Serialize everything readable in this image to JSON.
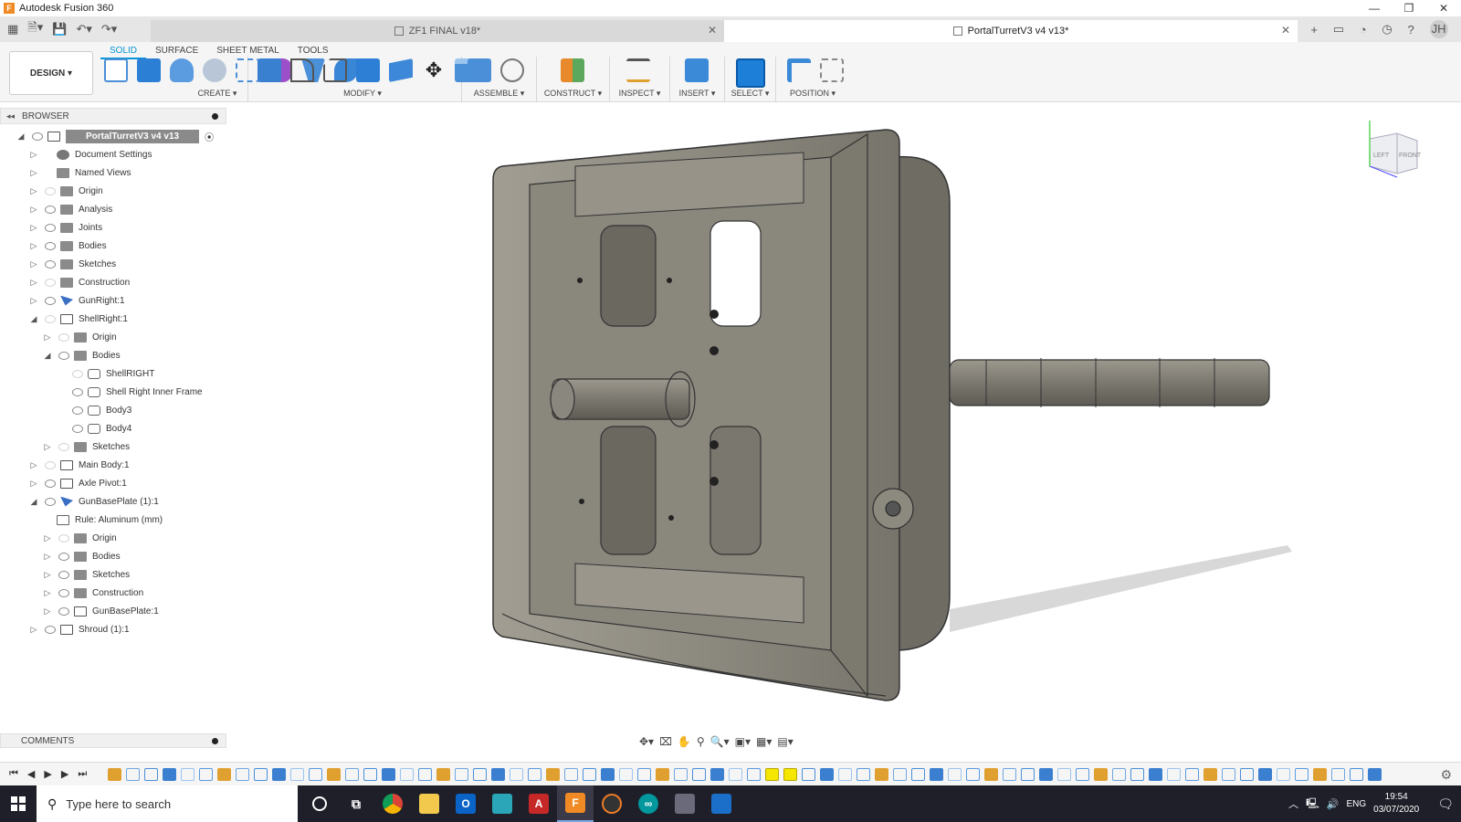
{
  "window": {
    "title": "Autodesk Fusion 360",
    "app_icon": "F"
  },
  "tabs": {
    "inactive": {
      "label": "ZF1 FINAL v18*"
    },
    "active": {
      "label": "PortalTurretV3 v4 v13*"
    }
  },
  "user": {
    "initials": "JH"
  },
  "ribbon": {
    "mode": "DESIGN ▾",
    "tabs": [
      "SOLID",
      "SURFACE",
      "SHEET METAL",
      "TOOLS"
    ],
    "groups": {
      "create": "CREATE ▾",
      "modify": "MODIFY ▾",
      "assemble": "ASSEMBLE ▾",
      "construct": "CONSTRUCT ▾",
      "inspect": "INSPECT ▾",
      "insert": "INSERT ▾",
      "select": "SELECT ▾",
      "position": "POSITION ▾"
    }
  },
  "browser": {
    "title": "BROWSER",
    "items": [
      "PortalTurretV3 v4 v13",
      "Document Settings",
      "Named Views",
      "Origin",
      "Analysis",
      "Joints",
      "Bodies",
      "Sketches",
      "Construction",
      "GunRight:1",
      "ShellRight:1",
      "Origin",
      "Bodies",
      "ShellRIGHT",
      "Shell Right Inner Frame",
      "Body3",
      "Body4",
      "Sketches",
      "Main Body:1",
      "Axle Pivot:1",
      "GunBasePlate (1):1",
      "Rule: Aluminum (mm)",
      "Origin",
      "Bodies",
      "Sketches",
      "Construction",
      "GunBasePlate:1",
      "Shroud (1):1"
    ]
  },
  "viewcube": {
    "left": "LEFT",
    "front": "FRONT"
  },
  "comments": {
    "title": "COMMENTS"
  },
  "taskbar": {
    "search_placeholder": "Type here to search",
    "lang": "ENG",
    "time": "19:54",
    "date": "03/07/2020"
  },
  "colors": {
    "accent": "#0696d7",
    "model": "#8d8a80",
    "taskbar": "#1f1f2a"
  }
}
